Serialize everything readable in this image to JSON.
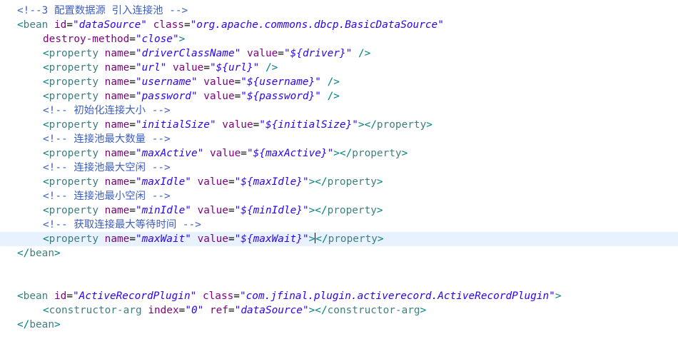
{
  "editor": {
    "lines": {
      "l1": {
        "comment": "<!--3 配置数据源 引入连接池 -->"
      },
      "l2": {
        "open": "<",
        "tag": "bean",
        "a1": "id",
        "v1": "\"dataSource\"",
        "a2": "class",
        "v2": "\"org.apache.commons.dbcp.BasicDataSource\""
      },
      "l3": {
        "a1": "destroy-method",
        "v1": "\"close\"",
        "close": ">"
      },
      "l4": {
        "open": "<",
        "tag": "property",
        "a1": "name",
        "v1": "\"driverClassName\"",
        "a2": "value",
        "v2": "\"${driver}\"",
        "close": "/>"
      },
      "l5": {
        "open": "<",
        "tag": "property",
        "a1": "name",
        "v1": "\"url\"",
        "a2": "value",
        "v2": "\"${url}\"",
        "close": "/>"
      },
      "l6": {
        "open": "<",
        "tag": "property",
        "a1": "name",
        "v1": "\"username\"",
        "a2": "value",
        "v2": "\"${username}\"",
        "close": "/>"
      },
      "l7": {
        "open": "<",
        "tag": "property",
        "a1": "name",
        "v1": "\"password\"",
        "a2": "value",
        "v2": "\"${password}\"",
        "close": "/>"
      },
      "l8": {
        "comment": "<!-- 初始化连接大小 -->"
      },
      "l9": {
        "open": "<",
        "tag": "property",
        "a1": "name",
        "v1": "\"initialSize\"",
        "a2": "value",
        "v2": "\"${initialSize}\"",
        "close": "></",
        "tag2": "property",
        "close2": ">"
      },
      "l10": {
        "comment": "<!-- 连接池最大数量 -->"
      },
      "l11": {
        "open": "<",
        "tag": "property",
        "a1": "name",
        "v1": "\"maxActive\"",
        "a2": "value",
        "v2": "\"${maxActive}\"",
        "close": "></",
        "tag2": "property",
        "close2": ">"
      },
      "l12": {
        "comment": "<!-- 连接池最大空闲 -->"
      },
      "l13": {
        "open": "<",
        "tag": "property",
        "a1": "name",
        "v1": "\"maxIdle\"",
        "a2": "value",
        "v2": "\"${maxIdle}\"",
        "close": "></",
        "tag2": "property",
        "close2": ">"
      },
      "l14": {
        "comment": "<!-- 连接池最小空闲 -->"
      },
      "l15": {
        "open": "<",
        "tag": "property",
        "a1": "name",
        "v1": "\"minIdle\"",
        "a2": "value",
        "v2": "\"${minIdle}\"",
        "close": "></",
        "tag2": "property",
        "close2": ">"
      },
      "l16": {
        "comment": "<!-- 获取连接最大等待时间 -->"
      },
      "l17": {
        "open": "<",
        "tag": "property",
        "a1": "name",
        "v1": "\"maxWait\"",
        "a2": "value",
        "v2": "\"${maxWait}\"",
        "close": ">",
        "close_b": "</",
        "tag2": "property",
        "close2": ">"
      },
      "l18": {
        "open": "</",
        "tag": "bean",
        "close": ">"
      },
      "l21": {
        "open": "<",
        "tag": "bean",
        "a1": "id",
        "v1": "\"ActiveRecordPlugin\"",
        "a2": "class",
        "v2": "\"com.jfinal.plugin.activerecord.ActiveRecordPlugin\"",
        "close": ">"
      },
      "l22": {
        "open": "<",
        "tag": "constructor-arg",
        "a1": "index",
        "v1": "\"0\"",
        "a2": "ref",
        "v2": "\"dataSource\"",
        "close": "></",
        "tag2": "constructor-arg",
        "close2": ">"
      },
      "l23": {
        "open": "</",
        "tag": "bean",
        "close": ">"
      }
    },
    "colors": {
      "tag": "#3f7f7f",
      "attribute": "#7f007f",
      "value": "#2a00ff",
      "comment": "#3f5fbf",
      "current_line": "#e8f2fe"
    }
  }
}
